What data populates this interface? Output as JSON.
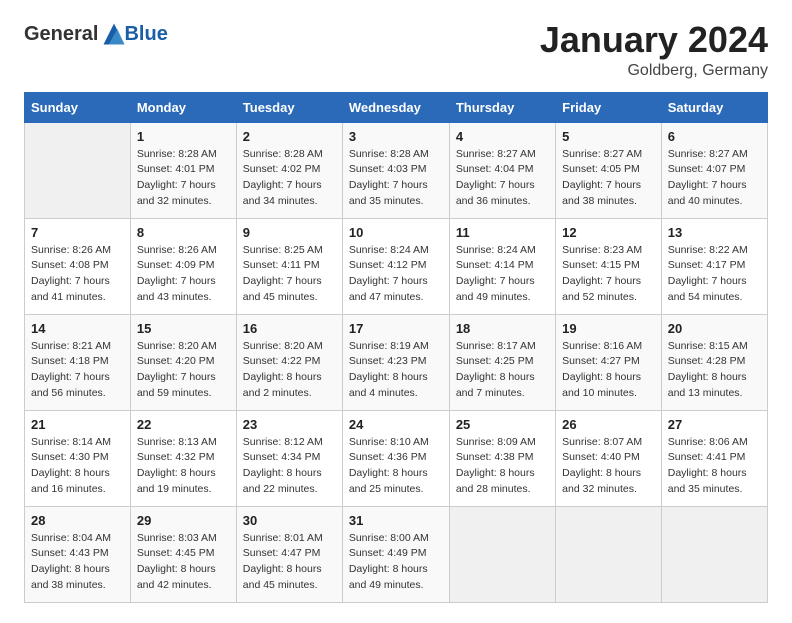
{
  "header": {
    "logo_general": "General",
    "logo_blue": "Blue",
    "title": "January 2024",
    "location": "Goldberg, Germany"
  },
  "days_of_week": [
    "Sunday",
    "Monday",
    "Tuesday",
    "Wednesday",
    "Thursday",
    "Friday",
    "Saturday"
  ],
  "weeks": [
    [
      {
        "day": "",
        "sunrise": "",
        "sunset": "",
        "daylight": ""
      },
      {
        "day": "1",
        "sunrise": "Sunrise: 8:28 AM",
        "sunset": "Sunset: 4:01 PM",
        "daylight": "Daylight: 7 hours and 32 minutes."
      },
      {
        "day": "2",
        "sunrise": "Sunrise: 8:28 AM",
        "sunset": "Sunset: 4:02 PM",
        "daylight": "Daylight: 7 hours and 34 minutes."
      },
      {
        "day": "3",
        "sunrise": "Sunrise: 8:28 AM",
        "sunset": "Sunset: 4:03 PM",
        "daylight": "Daylight: 7 hours and 35 minutes."
      },
      {
        "day": "4",
        "sunrise": "Sunrise: 8:27 AM",
        "sunset": "Sunset: 4:04 PM",
        "daylight": "Daylight: 7 hours and 36 minutes."
      },
      {
        "day": "5",
        "sunrise": "Sunrise: 8:27 AM",
        "sunset": "Sunset: 4:05 PM",
        "daylight": "Daylight: 7 hours and 38 minutes."
      },
      {
        "day": "6",
        "sunrise": "Sunrise: 8:27 AM",
        "sunset": "Sunset: 4:07 PM",
        "daylight": "Daylight: 7 hours and 40 minutes."
      }
    ],
    [
      {
        "day": "7",
        "sunrise": "Sunrise: 8:26 AM",
        "sunset": "Sunset: 4:08 PM",
        "daylight": "Daylight: 7 hours and 41 minutes."
      },
      {
        "day": "8",
        "sunrise": "Sunrise: 8:26 AM",
        "sunset": "Sunset: 4:09 PM",
        "daylight": "Daylight: 7 hours and 43 minutes."
      },
      {
        "day": "9",
        "sunrise": "Sunrise: 8:25 AM",
        "sunset": "Sunset: 4:11 PM",
        "daylight": "Daylight: 7 hours and 45 minutes."
      },
      {
        "day": "10",
        "sunrise": "Sunrise: 8:24 AM",
        "sunset": "Sunset: 4:12 PM",
        "daylight": "Daylight: 7 hours and 47 minutes."
      },
      {
        "day": "11",
        "sunrise": "Sunrise: 8:24 AM",
        "sunset": "Sunset: 4:14 PM",
        "daylight": "Daylight: 7 hours and 49 minutes."
      },
      {
        "day": "12",
        "sunrise": "Sunrise: 8:23 AM",
        "sunset": "Sunset: 4:15 PM",
        "daylight": "Daylight: 7 hours and 52 minutes."
      },
      {
        "day": "13",
        "sunrise": "Sunrise: 8:22 AM",
        "sunset": "Sunset: 4:17 PM",
        "daylight": "Daylight: 7 hours and 54 minutes."
      }
    ],
    [
      {
        "day": "14",
        "sunrise": "Sunrise: 8:21 AM",
        "sunset": "Sunset: 4:18 PM",
        "daylight": "Daylight: 7 hours and 56 minutes."
      },
      {
        "day": "15",
        "sunrise": "Sunrise: 8:20 AM",
        "sunset": "Sunset: 4:20 PM",
        "daylight": "Daylight: 7 hours and 59 minutes."
      },
      {
        "day": "16",
        "sunrise": "Sunrise: 8:20 AM",
        "sunset": "Sunset: 4:22 PM",
        "daylight": "Daylight: 8 hours and 2 minutes."
      },
      {
        "day": "17",
        "sunrise": "Sunrise: 8:19 AM",
        "sunset": "Sunset: 4:23 PM",
        "daylight": "Daylight: 8 hours and 4 minutes."
      },
      {
        "day": "18",
        "sunrise": "Sunrise: 8:17 AM",
        "sunset": "Sunset: 4:25 PM",
        "daylight": "Daylight: 8 hours and 7 minutes."
      },
      {
        "day": "19",
        "sunrise": "Sunrise: 8:16 AM",
        "sunset": "Sunset: 4:27 PM",
        "daylight": "Daylight: 8 hours and 10 minutes."
      },
      {
        "day": "20",
        "sunrise": "Sunrise: 8:15 AM",
        "sunset": "Sunset: 4:28 PM",
        "daylight": "Daylight: 8 hours and 13 minutes."
      }
    ],
    [
      {
        "day": "21",
        "sunrise": "Sunrise: 8:14 AM",
        "sunset": "Sunset: 4:30 PM",
        "daylight": "Daylight: 8 hours and 16 minutes."
      },
      {
        "day": "22",
        "sunrise": "Sunrise: 8:13 AM",
        "sunset": "Sunset: 4:32 PM",
        "daylight": "Daylight: 8 hours and 19 minutes."
      },
      {
        "day": "23",
        "sunrise": "Sunrise: 8:12 AM",
        "sunset": "Sunset: 4:34 PM",
        "daylight": "Daylight: 8 hours and 22 minutes."
      },
      {
        "day": "24",
        "sunrise": "Sunrise: 8:10 AM",
        "sunset": "Sunset: 4:36 PM",
        "daylight": "Daylight: 8 hours and 25 minutes."
      },
      {
        "day": "25",
        "sunrise": "Sunrise: 8:09 AM",
        "sunset": "Sunset: 4:38 PM",
        "daylight": "Daylight: 8 hours and 28 minutes."
      },
      {
        "day": "26",
        "sunrise": "Sunrise: 8:07 AM",
        "sunset": "Sunset: 4:40 PM",
        "daylight": "Daylight: 8 hours and 32 minutes."
      },
      {
        "day": "27",
        "sunrise": "Sunrise: 8:06 AM",
        "sunset": "Sunset: 4:41 PM",
        "daylight": "Daylight: 8 hours and 35 minutes."
      }
    ],
    [
      {
        "day": "28",
        "sunrise": "Sunrise: 8:04 AM",
        "sunset": "Sunset: 4:43 PM",
        "daylight": "Daylight: 8 hours and 38 minutes."
      },
      {
        "day": "29",
        "sunrise": "Sunrise: 8:03 AM",
        "sunset": "Sunset: 4:45 PM",
        "daylight": "Daylight: 8 hours and 42 minutes."
      },
      {
        "day": "30",
        "sunrise": "Sunrise: 8:01 AM",
        "sunset": "Sunset: 4:47 PM",
        "daylight": "Daylight: 8 hours and 45 minutes."
      },
      {
        "day": "31",
        "sunrise": "Sunrise: 8:00 AM",
        "sunset": "Sunset: 4:49 PM",
        "daylight": "Daylight: 8 hours and 49 minutes."
      },
      {
        "day": "",
        "sunrise": "",
        "sunset": "",
        "daylight": ""
      },
      {
        "day": "",
        "sunrise": "",
        "sunset": "",
        "daylight": ""
      },
      {
        "day": "",
        "sunrise": "",
        "sunset": "",
        "daylight": ""
      }
    ]
  ]
}
